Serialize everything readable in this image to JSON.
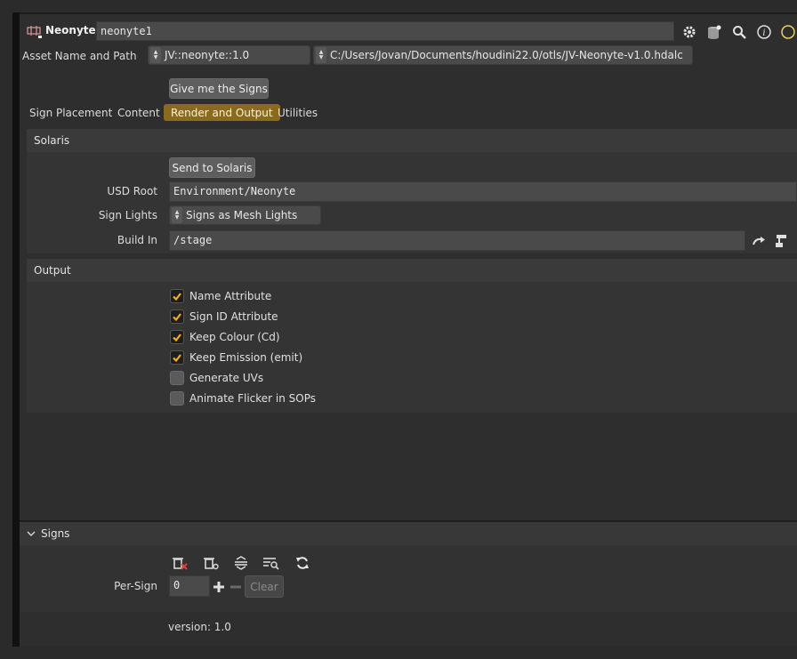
{
  "header": {
    "node_type": "Neonyte",
    "node_name": "neonyte1",
    "icons": [
      "gear-icon",
      "asset-icon",
      "search-icon",
      "info-icon"
    ]
  },
  "asset": {
    "label": "Asset Name and Path",
    "name": "JV::neonyte::1.0",
    "path": "C:/Users/Jovan/Documents/houdini22.0/otls/JV-Neonyte-v1.0.hdalc"
  },
  "top_button": "Give me the Signs",
  "tabs": [
    {
      "label": "Sign Placement",
      "active": false
    },
    {
      "label": "Content",
      "active": false
    },
    {
      "label": "Render and Output",
      "active": true
    },
    {
      "label": "Utilities",
      "active": false
    }
  ],
  "solaris": {
    "title": "Solaris",
    "send_button": "Send to Solaris",
    "usd_root_label": "USD Root",
    "usd_root_value": "Environment/Neonyte",
    "sign_lights_label": "Sign Lights",
    "sign_lights_value": "Signs as Mesh Lights",
    "build_in_label": "Build In",
    "build_in_value": "/stage"
  },
  "output": {
    "title": "Output",
    "options": [
      {
        "label": "Name Attribute",
        "checked": true
      },
      {
        "label": "Sign ID Attribute",
        "checked": true
      },
      {
        "label": "Keep Colour (Cd)",
        "checked": true
      },
      {
        "label": "Keep Emission (emit)",
        "checked": true
      },
      {
        "label": "Generate UVs",
        "checked": false
      },
      {
        "label": "Animate Flicker in SOPs",
        "checked": false
      }
    ]
  },
  "signs": {
    "title": "Signs",
    "per_sign_label": "Per-Sign",
    "per_sign_value": "0",
    "clear_button": "Clear"
  },
  "version": "version: 1.0",
  "colors": {
    "accent_tab": "#8a6a1e",
    "checkmark": "#f0b020",
    "background": "#2e2e2e"
  }
}
